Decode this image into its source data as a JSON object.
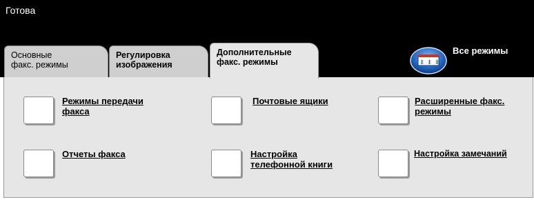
{
  "status": {
    "text": "Готова"
  },
  "tabs": [
    {
      "line1": "Основные",
      "line2": "факс. режимы"
    },
    {
      "line1": "Регулировка",
      "line2": "изображения"
    },
    {
      "line1": "Дополнительные",
      "line2": "факс. режимы"
    }
  ],
  "all_modes": {
    "label": "Все режимы",
    "icon": "all-modes-icon"
  },
  "options": [
    {
      "line1": "Режимы передачи",
      "line2": "факса"
    },
    {
      "line1": "Почтовые ящики",
      "line2": ""
    },
    {
      "line1": "Расширенные факс.",
      "line2": "режимы"
    },
    {
      "line1": "Отчеты факса",
      "line2": ""
    },
    {
      "line1": "Настройка",
      "line2": "телефонной книги"
    },
    {
      "line1": "Настройка замечаний",
      "line2": ""
    }
  ],
  "colors": {
    "header_bg": "#000000",
    "panel_bg": "#e6e6e6",
    "accent_blue": "#1e5fb5"
  }
}
